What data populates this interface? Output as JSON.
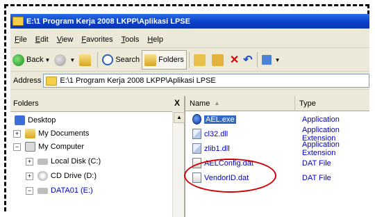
{
  "window": {
    "title": "E:\\1 Program Kerja 2008 LKPP\\Aplikasi LPSE"
  },
  "menu": [
    "File",
    "Edit",
    "View",
    "Favorites",
    "Tools",
    "Help"
  ],
  "toolbar": {
    "back_label": "Back",
    "search_label": "Search",
    "folders_label": "Folders"
  },
  "address": {
    "label": "Address",
    "value": "E:\\1 Program Kerja 2008 LKPP\\Aplikasi LPSE"
  },
  "folders_pane": {
    "title": "Folders",
    "close": "X",
    "tree": [
      {
        "label": "Desktop",
        "icon": "desktop-icon",
        "expander": ""
      },
      {
        "label": "My Documents",
        "icon": "folder-icon",
        "expander": "+"
      },
      {
        "label": "My Computer",
        "icon": "computer-icon",
        "expander": "−"
      },
      {
        "label": "Local Disk (C:)",
        "icon": "drive-icon",
        "expander": "+"
      },
      {
        "label": "CD Drive (D:)",
        "icon": "cd-drive-icon",
        "expander": "+"
      },
      {
        "label": "DATA01 (E:)",
        "icon": "drive-icon",
        "expander": "−"
      }
    ]
  },
  "files": {
    "columns": {
      "name": "Name",
      "type": "Type"
    },
    "rows": [
      {
        "name": "AEL.exe",
        "type": "Application",
        "icon": "exe-icon",
        "selected": true
      },
      {
        "name": "cl32.dll",
        "type": "Application Extension",
        "icon": "dll-icon"
      },
      {
        "name": "zlib1.dll",
        "type": "Application Extension",
        "icon": "dll-icon"
      },
      {
        "name": "AELConfig.dat",
        "type": "DAT File",
        "icon": "dat-icon"
      },
      {
        "name": "VendorID.dat",
        "type": "DAT File",
        "icon": "dat-icon"
      }
    ]
  },
  "colors": {
    "title_bar": "#0b3fc8",
    "highlight_circle": "#d40000",
    "link_blue": "#0000cc"
  }
}
